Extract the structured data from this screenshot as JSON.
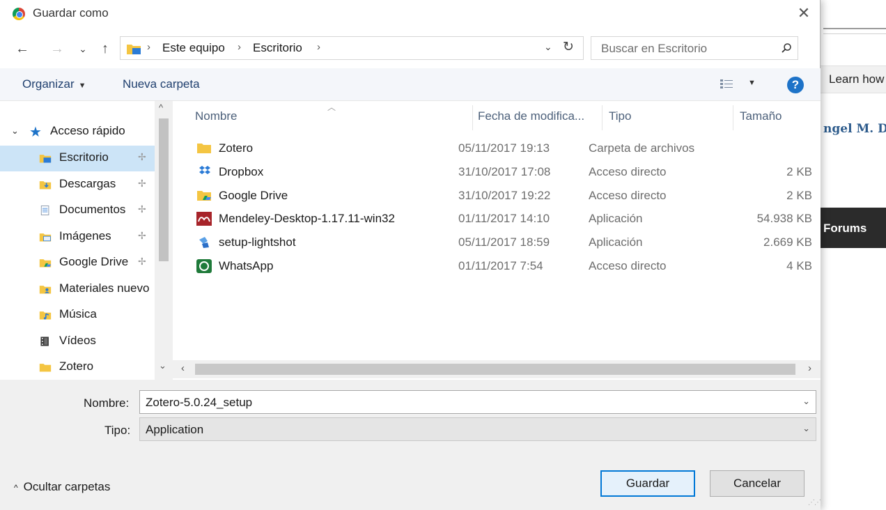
{
  "background_page": {
    "learn_text": "Learn how",
    "name_fragment": "ngel M. D",
    "forums": "Forums"
  },
  "dialog": {
    "title": "Guardar como",
    "close_icon": "close-icon"
  },
  "navigation": {
    "back": "←",
    "forward": "→",
    "recent": "⌄",
    "up": "↑"
  },
  "address": {
    "crumbs": [
      "Este equipo",
      "Escritorio"
    ],
    "refresh_icon": "refresh-icon"
  },
  "search": {
    "placeholder": "Buscar en Escritorio"
  },
  "toolbar": {
    "organize": "Organizar",
    "new_folder": "Nueva carpeta",
    "view_icon": "view-options-icon",
    "help": "?"
  },
  "nav_pane": {
    "quick_access": "Acceso rápido",
    "items": [
      {
        "label": "Escritorio",
        "pinned": true,
        "selected": true,
        "icon": "desktop-folder-icon"
      },
      {
        "label": "Descargas",
        "pinned": true,
        "icon": "downloads-folder-icon"
      },
      {
        "label": "Documentos",
        "pinned": true,
        "icon": "documents-folder-icon"
      },
      {
        "label": "Imágenes",
        "pinned": true,
        "icon": "pictures-folder-icon"
      },
      {
        "label": "Google Drive",
        "pinned": true,
        "icon": "google-drive-folder-icon"
      },
      {
        "label": "Materiales nuevo",
        "pinned": false,
        "icon": "user-folder-icon"
      },
      {
        "label": "Música",
        "pinned": false,
        "icon": "music-folder-icon"
      },
      {
        "label": "Vídeos",
        "pinned": false,
        "icon": "videos-folder-icon"
      },
      {
        "label": "Zotero",
        "pinned": false,
        "icon": "folder-icon"
      }
    ]
  },
  "file_list": {
    "columns": {
      "name": "Nombre",
      "date": "Fecha de modifica...",
      "type": "Tipo",
      "size": "Tamaño"
    },
    "rows": [
      {
        "name": "Zotero",
        "date": "05/11/2017 19:13",
        "type": "Carpeta de archivos",
        "size": "",
        "icon": "folder-icon"
      },
      {
        "name": "Dropbox",
        "date": "31/10/2017 17:08",
        "type": "Acceso directo",
        "size": "2 KB",
        "icon": "dropbox-icon"
      },
      {
        "name": "Google Drive",
        "date": "31/10/2017 19:22",
        "type": "Acceso directo",
        "size": "2 KB",
        "icon": "google-drive-icon"
      },
      {
        "name": "Mendeley-Desktop-1.17.11-win32",
        "date": "01/11/2017 14:10",
        "type": "Aplicación",
        "size": "54.938 KB",
        "icon": "mendeley-icon"
      },
      {
        "name": "setup-lightshot",
        "date": "05/11/2017 18:59",
        "type": "Aplicación",
        "size": "2.669 KB",
        "icon": "lightshot-icon"
      },
      {
        "name": "WhatsApp",
        "date": "01/11/2017 7:54",
        "type": "Acceso directo",
        "size": "4 KB",
        "icon": "whatsapp-icon"
      }
    ]
  },
  "form": {
    "name_label": "Nombre:",
    "name_value": "Zotero-5.0.24_setup",
    "type_label": "Tipo:",
    "type_value": "Application"
  },
  "footer": {
    "hide_folders": "Ocultar carpetas",
    "save": "Guardar",
    "cancel": "Cancelar"
  },
  "colors": {
    "accent": "#0078d7",
    "selection": "#cce4f7",
    "link": "#1f3f6e"
  }
}
